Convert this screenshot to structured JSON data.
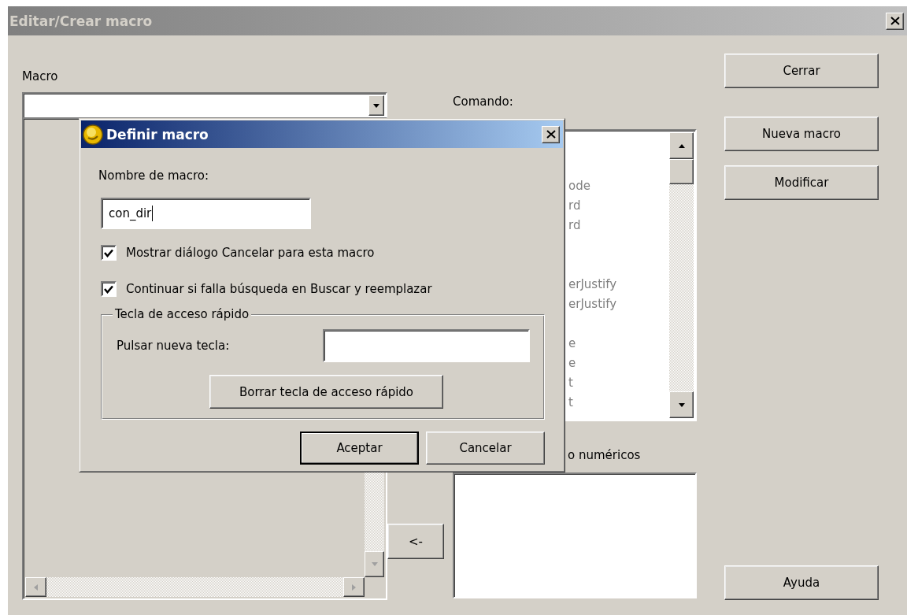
{
  "window": {
    "title": "Editar/Crear macro",
    "active": false
  },
  "macro": {
    "label": "Macro"
  },
  "command": {
    "label": "Comando:",
    "disabled": true,
    "rows": [
      {
        "kind": "hidden"
      },
      {
        "kind": "hidden"
      },
      {
        "kind": "text",
        "text": "ode"
      },
      {
        "kind": "text",
        "text": "rd"
      },
      {
        "kind": "text",
        "text": "rd"
      },
      {
        "kind": "hidden"
      },
      {
        "kind": "hidden"
      },
      {
        "kind": "text",
        "text": "erJustify"
      },
      {
        "kind": "text",
        "text": "erJustify"
      },
      {
        "kind": "hidden"
      },
      {
        "kind": "text",
        "text": "e"
      },
      {
        "kind": "text",
        "text": "e"
      },
      {
        "kind": "text",
        "text": "t"
      },
      {
        "kind": "text",
        "text": "t"
      }
    ]
  },
  "numeric_label": "o numéricos",
  "move_button": "<-",
  "side_buttons": [
    "Cerrar",
    "Nueva macro",
    "Modificar"
  ],
  "help_button": "Ayuda",
  "dialog": {
    "title": "Definir macro",
    "active": true,
    "name_label": "Nombre de macro:",
    "name_value": "con_dir",
    "options": [
      {
        "label": "Mostrar diálogo Cancelar para esta macro",
        "checked": true
      },
      {
        "label": "Continuar si falla búsqueda en Buscar y reemplazar",
        "checked": true
      }
    ],
    "hotkey_group": {
      "legend": "Tecla de acceso rápido",
      "key_label": "Pulsar nueva tecla:",
      "clear_button": "Borrar tecla de acceso rápido"
    },
    "buttons": [
      {
        "label": "Aceptar",
        "default": true
      },
      {
        "label": "Cancelar",
        "default": false
      }
    ]
  }
}
